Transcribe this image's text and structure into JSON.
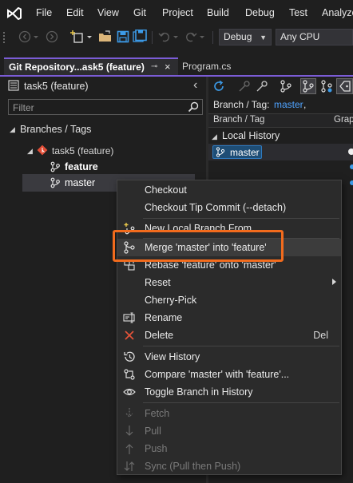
{
  "menubar": {
    "items": [
      "File",
      "Edit",
      "View",
      "Git",
      "Project",
      "Build",
      "Debug",
      "Test",
      "Analyze"
    ]
  },
  "toolbar": {
    "configuration": "Debug",
    "platform": "Any CPU"
  },
  "tabs": [
    {
      "label": "Git Repository...ask5 (feature)",
      "active": true
    },
    {
      "label": "Program.cs",
      "active": false
    }
  ],
  "left_pane": {
    "repo_title": "task5 (feature)",
    "filter_placeholder": "Filter",
    "section_header": "Branches / Tags",
    "repo_node": "task5 (feature)",
    "branches": [
      {
        "label": "feature",
        "bold": true
      },
      {
        "label": "master",
        "bold": false,
        "selected": true
      }
    ]
  },
  "right_pane": {
    "branch_tag_label": "Branch / Tag:",
    "branch_tag_value": "master",
    "branch_tag_suffix": ",",
    "col_branch_tag": "Branch / Tag",
    "col_graph": "Grap",
    "local_history_label": "Local History",
    "branch_badge": "master"
  },
  "context_menu": {
    "items": [
      {
        "label": "Checkout",
        "icon": "none"
      },
      {
        "label": "Checkout Tip Commit (--detach)",
        "icon": "none"
      },
      {
        "separator": true
      },
      {
        "label": "New Local Branch From...",
        "icon": "new-branch-icon"
      },
      {
        "label": "Merge 'master' into 'feature'",
        "icon": "merge-icon",
        "highlighted": true
      },
      {
        "label": "Rebase 'feature' onto 'master'",
        "icon": "rebase-icon"
      },
      {
        "label": "Reset",
        "icon": "none",
        "submenu": true
      },
      {
        "label": "Cherry-Pick",
        "icon": "none"
      },
      {
        "label": "Rename",
        "icon": "rename-icon"
      },
      {
        "label": "Delete",
        "icon": "delete-icon",
        "shortcut": "Del"
      },
      {
        "separator": true
      },
      {
        "label": "View History",
        "icon": "history-icon"
      },
      {
        "label": "Compare 'master' with 'feature'...",
        "icon": "compare-icon"
      },
      {
        "label": "Toggle Branch in History",
        "icon": "eye-icon"
      },
      {
        "separator": true
      },
      {
        "label": "Fetch",
        "icon": "fetch-icon",
        "disabled": true
      },
      {
        "label": "Pull",
        "icon": "pull-icon",
        "disabled": true
      },
      {
        "label": "Push",
        "icon": "push-icon",
        "disabled": true
      },
      {
        "label": "Sync (Pull then Push)",
        "icon": "sync-icon",
        "disabled": true
      }
    ]
  },
  "colors": {
    "accent": "#7b5cd6",
    "callout": "#f26b1d",
    "link_blue": "#4fa3ff",
    "badge_bg": "#1e4d75"
  }
}
